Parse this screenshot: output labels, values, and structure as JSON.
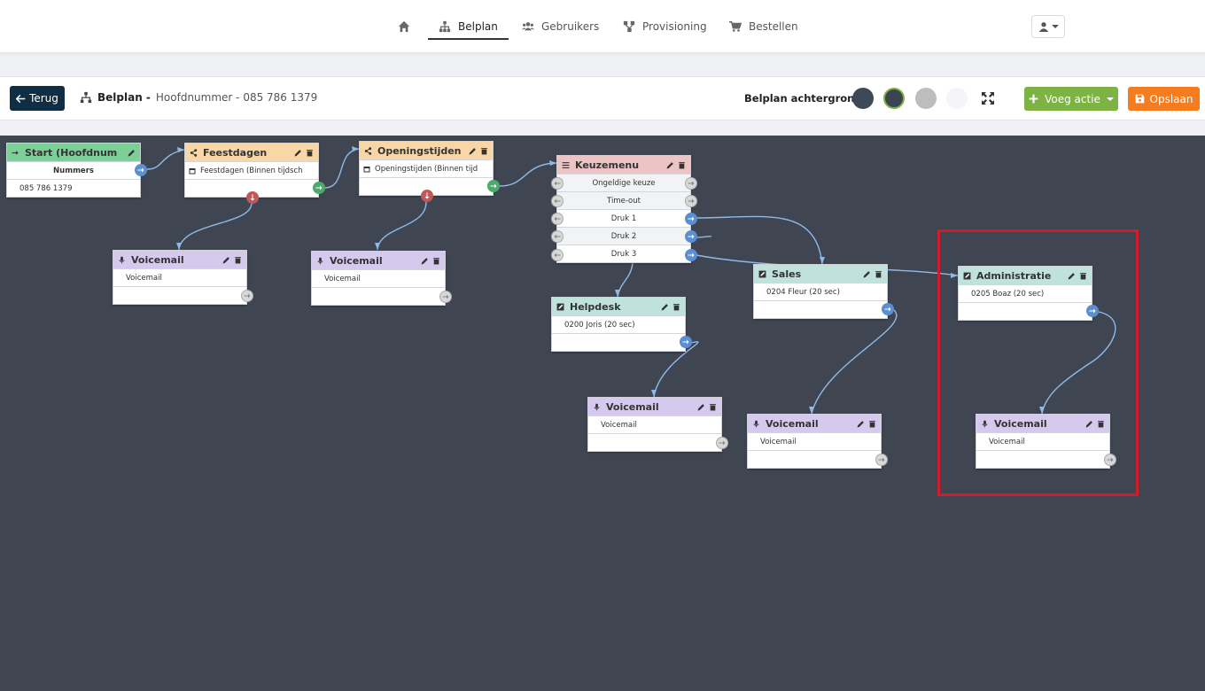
{
  "nav": {
    "items": [
      {
        "label": "",
        "icon": "home-icon"
      },
      {
        "label": "Belplan",
        "icon": "sitemap-icon"
      },
      {
        "label": "Gebruikers",
        "icon": "users-icon"
      },
      {
        "label": "Provisioning",
        "icon": "network-icon"
      },
      {
        "label": "Bestellen",
        "icon": "cart-icon"
      }
    ],
    "active": "Belplan"
  },
  "toolbar": {
    "back_label": "Terug",
    "crumb_bold": "Belplan -",
    "crumb_rest": "Hoofdnummer - 085 786 1379",
    "bg_label": "Belplan achtergrond",
    "swatches": [
      "#3d4957",
      "#3a4551",
      "#bdbdbd",
      "#f4f5f8"
    ],
    "add_label": "Voeg actie",
    "save_label": "Opslaan"
  },
  "nodes": {
    "start": {
      "title": "Start (Hoofdnum",
      "rows": [
        "Nummers",
        "085 786 1379"
      ]
    },
    "feestdagen": {
      "title": "Feestdagen",
      "rows": [
        "Feestdagen (Binnen tijdsch"
      ]
    },
    "openingstijden": {
      "title": "Openingstijden",
      "rows": [
        "Openingstijden (Binnen tijd"
      ]
    },
    "keuzemenu": {
      "title": "Keuzemenu",
      "rows": [
        "Ongeldige keuze",
        "Time-out",
        "Druk 1",
        "Druk 2",
        "Druk 3"
      ]
    },
    "vm1": {
      "title": "Voicemail",
      "rows": [
        "Voicemail"
      ]
    },
    "vm2": {
      "title": "Voicemail",
      "rows": [
        "Voicemail"
      ]
    },
    "helpdesk": {
      "title": "Helpdesk",
      "rows": [
        "0200 Joris (20 sec)"
      ]
    },
    "sales": {
      "title": "Sales",
      "rows": [
        "0204 Fleur (20 sec)"
      ]
    },
    "administratie": {
      "title": "Administratie",
      "rows": [
        "0205 Boaz (20 sec)"
      ]
    },
    "vm3": {
      "title": "Voicemail",
      "rows": [
        "Voicemail"
      ]
    },
    "vm4": {
      "title": "Voicemail",
      "rows": [
        "Voicemail"
      ]
    },
    "vm5": {
      "title": "Voicemail",
      "rows": [
        "Voicemail"
      ]
    }
  }
}
